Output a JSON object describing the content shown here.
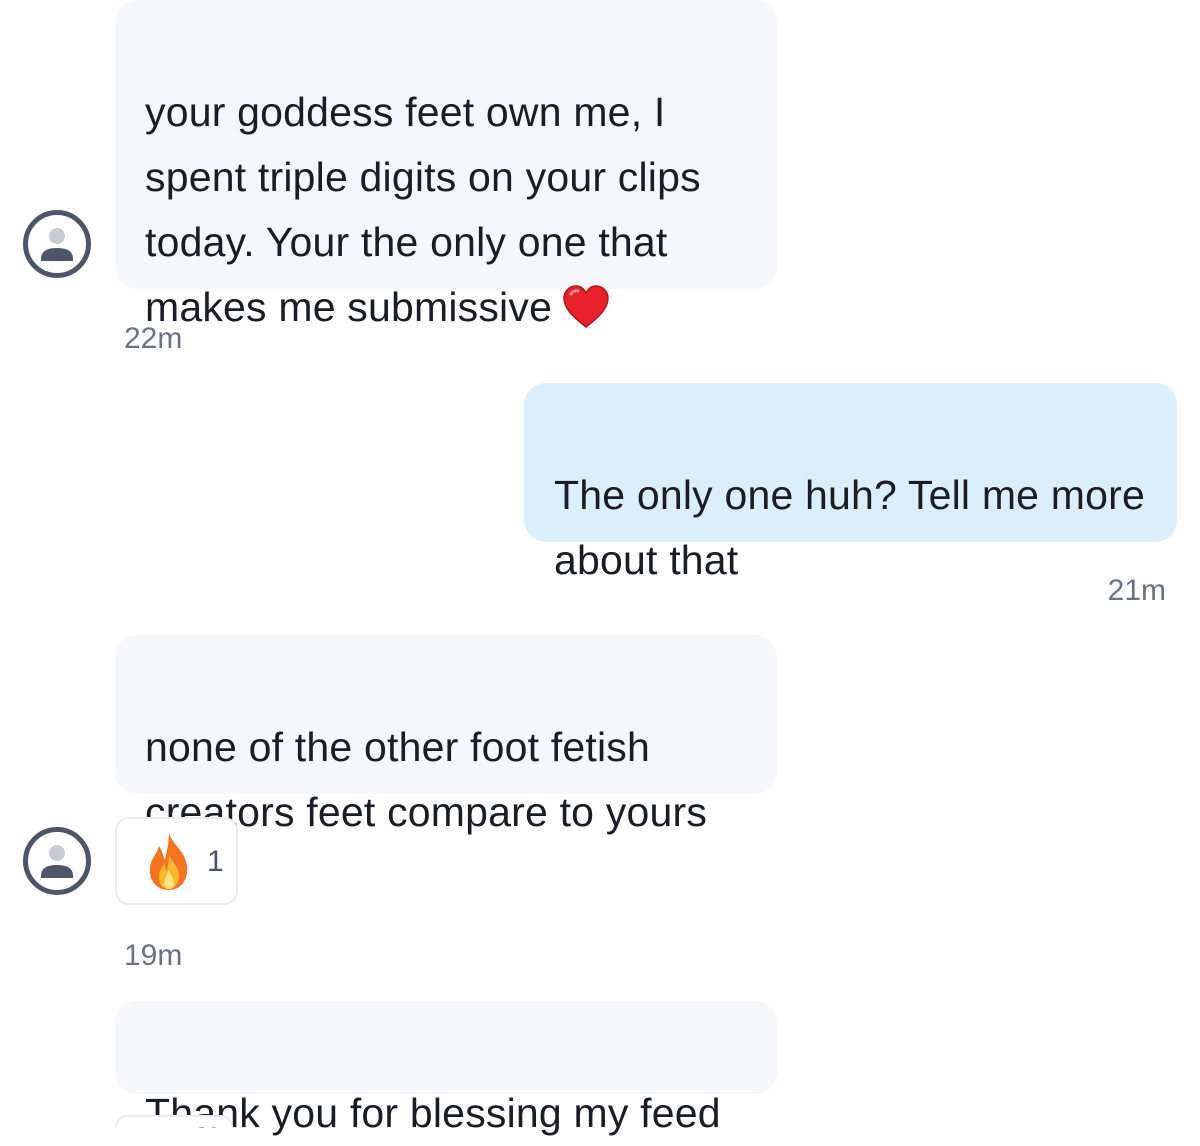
{
  "conversation": {
    "messages": [
      {
        "id": "m1",
        "direction": "incoming",
        "text": "your goddess feet own me, I\nspent triple digits on your clips\ntoday. Your the only one that\nmakes me submissive",
        "emoji": "red-heart",
        "timestamp": "22m"
      },
      {
        "id": "m2",
        "direction": "outgoing",
        "text": "The only one huh? Tell me more\nabout that",
        "timestamp": "21m"
      },
      {
        "id": "m3",
        "direction": "incoming",
        "text": "none of the other foot fetish\ncreators feet compare to yours",
        "reaction": {
          "emoji": "fire",
          "count": "1"
        },
        "timestamp": "19m"
      },
      {
        "id": "m4",
        "direction": "incoming",
        "text": "Thank you for blessing my feed"
      }
    ]
  },
  "colors": {
    "incoming_bubble": "#f5f7fa",
    "outgoing_bubble": "#dbeefc",
    "timestamp_text": "#6b7280",
    "avatar_stroke": "#4d5666"
  },
  "icons": {
    "avatar": "default-user-avatar-icon",
    "heart": "red-heart-emoji",
    "fire": "fire-emoji"
  }
}
